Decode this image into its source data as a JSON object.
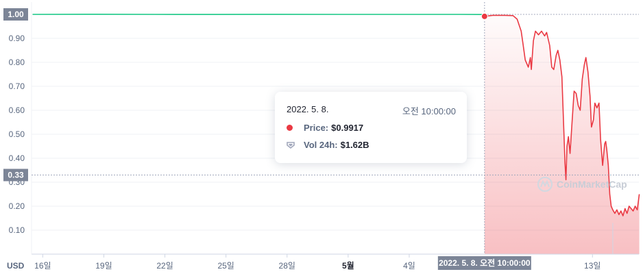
{
  "chart_data": {
    "type": "line",
    "unit_label": "USD",
    "yticks": [
      "0.10",
      "0.20",
      "0.30",
      "0.40",
      "0.50",
      "0.60",
      "0.70",
      "0.80",
      "0.90"
    ],
    "ylim": [
      0,
      1.05
    ],
    "xticks": [
      {
        "label": "16일",
        "x": 0.5
      },
      {
        "label": "19일",
        "x": 3.5
      },
      {
        "label": "22일",
        "x": 6.5
      },
      {
        "label": "25일",
        "x": 9.5
      },
      {
        "label": "28일",
        "x": 12.5
      },
      {
        "label": "5월",
        "x": 15.5,
        "bold": true
      },
      {
        "label": "4일",
        "x": 18.5
      },
      {
        "label": "13일",
        "x": 27.5
      }
    ],
    "xlim": [
      0,
      29.8
    ],
    "series": [
      {
        "color": "#16c784",
        "points": [
          [
            0,
            1.0
          ],
          [
            3,
            1.0005
          ],
          [
            6,
            1.0
          ],
          [
            9,
            0.9998
          ],
          [
            12,
            1.0002
          ],
          [
            15,
            1.0
          ],
          [
            18,
            1.0001
          ],
          [
            21,
            1.0
          ],
          [
            22.2,
            0.9995
          ]
        ]
      },
      {
        "color": "#ea3943",
        "points": [
          [
            22.2,
            0.9917
          ],
          [
            22.6,
            0.996
          ],
          [
            23.2,
            0.996
          ],
          [
            23.6,
            0.995
          ],
          [
            23.8,
            0.98
          ],
          [
            24.0,
            0.93
          ],
          [
            24.1,
            0.87
          ],
          [
            24.2,
            0.81
          ],
          [
            24.35,
            0.78
          ],
          [
            24.45,
            0.82
          ],
          [
            24.5,
            0.77
          ],
          [
            24.6,
            0.89
          ],
          [
            24.7,
            0.93
          ],
          [
            24.85,
            0.915
          ],
          [
            25.0,
            0.93
          ],
          [
            25.15,
            0.91
          ],
          [
            25.25,
            0.925
          ],
          [
            25.4,
            0.87
          ],
          [
            25.5,
            0.78
          ],
          [
            25.6,
            0.77
          ],
          [
            25.72,
            0.83
          ],
          [
            25.8,
            0.85
          ],
          [
            25.9,
            0.81
          ],
          [
            26.0,
            0.74
          ],
          [
            26.05,
            0.62
          ],
          [
            26.1,
            0.5
          ],
          [
            26.15,
            0.38
          ],
          [
            26.2,
            0.31
          ],
          [
            26.25,
            0.45
          ],
          [
            26.32,
            0.49
          ],
          [
            26.4,
            0.42
          ],
          [
            26.5,
            0.55
          ],
          [
            26.6,
            0.68
          ],
          [
            26.7,
            0.67
          ],
          [
            26.8,
            0.62
          ],
          [
            26.9,
            0.6
          ],
          [
            27.0,
            0.73
          ],
          [
            27.1,
            0.79
          ],
          [
            27.18,
            0.82
          ],
          [
            27.28,
            0.76
          ],
          [
            27.38,
            0.66
          ],
          [
            27.45,
            0.53
          ],
          [
            27.55,
            0.56
          ],
          [
            27.62,
            0.63
          ],
          [
            27.72,
            0.61
          ],
          [
            27.82,
            0.63
          ],
          [
            27.9,
            0.48
          ],
          [
            28.0,
            0.37
          ],
          [
            28.1,
            0.46
          ],
          [
            28.15,
            0.47
          ],
          [
            28.2,
            0.44
          ],
          [
            28.28,
            0.37
          ],
          [
            28.35,
            0.25
          ],
          [
            28.42,
            0.2
          ],
          [
            28.5,
            0.185
          ],
          [
            28.6,
            0.17
          ],
          [
            28.7,
            0.185
          ],
          [
            28.8,
            0.165
          ],
          [
            28.9,
            0.18
          ],
          [
            29.0,
            0.16
          ],
          [
            29.1,
            0.19
          ],
          [
            29.2,
            0.17
          ],
          [
            29.3,
            0.2
          ],
          [
            29.4,
            0.19
          ],
          [
            29.5,
            0.18
          ],
          [
            29.6,
            0.2
          ],
          [
            29.7,
            0.185
          ],
          [
            29.8,
            0.25
          ]
        ]
      }
    ],
    "crosshair": {
      "x": 22.2,
      "y": 0.9917,
      "y_label": "0.33",
      "x_label": "2022. 5. 8. 오전 10:00:00"
    },
    "y_tag_top": "1.00",
    "watermark": "CoinMarketCap"
  },
  "tooltip": {
    "date": "2022. 5. 8.",
    "time": "오전 10:00:00",
    "price_label": "Price:",
    "price_value": "$0.9917",
    "vol_label": "Vol 24h:",
    "vol_value": "$1.62B"
  }
}
